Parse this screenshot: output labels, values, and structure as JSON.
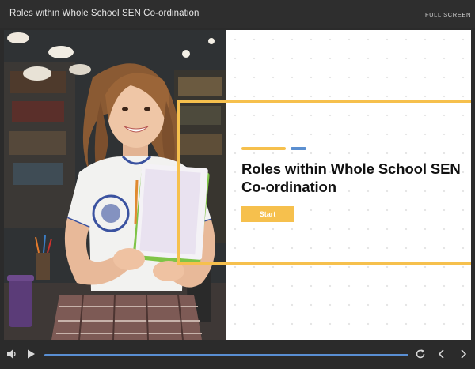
{
  "topbar": {
    "title": "Roles within Whole School SEN Co-ordination",
    "fullscreen_label": "FULL SCREEN"
  },
  "slide": {
    "heading": "Roles within Whole School SEN Co-ordination",
    "start_label": "Start",
    "photo_alt": "Smiling student holding notebooks in a library"
  },
  "colors": {
    "accent_yellow": "#f6c04d",
    "accent_blue": "#5b8fd0",
    "chrome_dark": "#2b2b2b"
  },
  "player": {
    "progress": 1.0,
    "icons": [
      "volume-icon",
      "play-icon",
      "replay-icon",
      "previous-icon",
      "next-icon"
    ]
  }
}
